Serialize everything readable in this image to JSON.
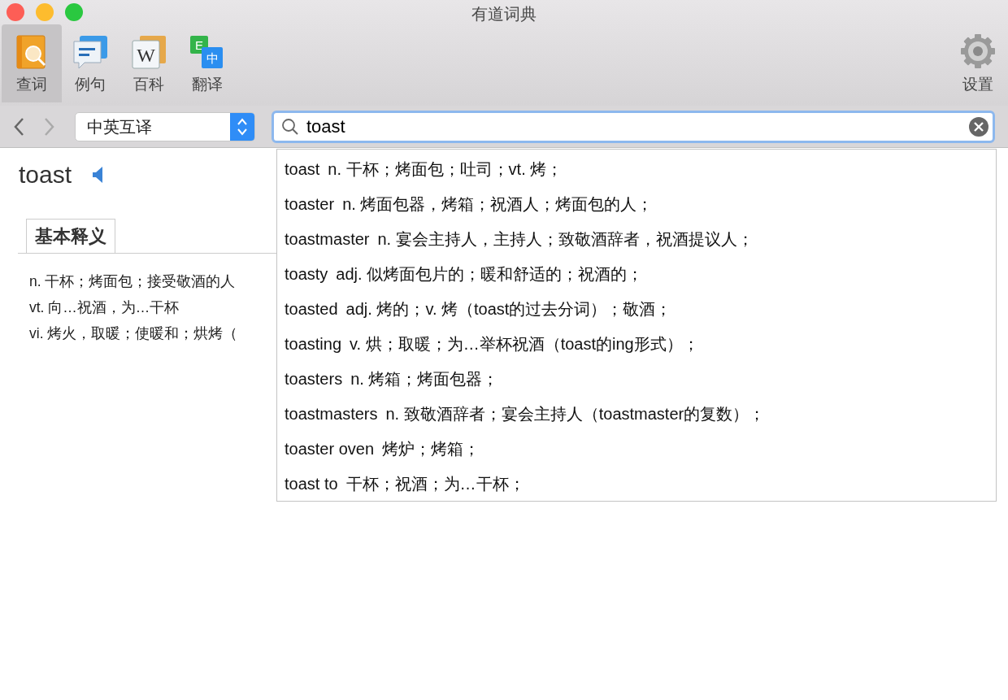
{
  "window": {
    "title": "有道词典"
  },
  "toolbar": {
    "items": [
      {
        "label": "查词",
        "kind": "lookup",
        "selected": true
      },
      {
        "label": "例句",
        "kind": "examples",
        "selected": false
      },
      {
        "label": "百科",
        "kind": "wiki",
        "icon_text": [
          "W"
        ],
        "selected": false
      },
      {
        "label": "翻译",
        "kind": "translate",
        "icon_text": [
          "E",
          "中"
        ],
        "selected": false
      }
    ],
    "settings": {
      "label": "设置"
    }
  },
  "nav": {
    "mode_select": {
      "value": "中英互译"
    },
    "search": {
      "value": "toast"
    }
  },
  "entry": {
    "word": "toast",
    "tabs": [
      {
        "label": "基本释义",
        "selected": true
      }
    ],
    "definitions": [
      "n. 干杯；烤面包；接受敬酒的人",
      "vt. 向…祝酒，为…干杯",
      "vi. 烤火，取暖；使暖和；烘烤（"
    ]
  },
  "suggestions": [
    {
      "word": "toast",
      "meaning": "n. 干杯；烤面包；吐司；vt. 烤；"
    },
    {
      "word": "toaster",
      "meaning": "n. 烤面包器，烤箱；祝酒人；烤面包的人；"
    },
    {
      "word": "toastmaster",
      "meaning": "n. 宴会主持人，主持人；致敬酒辞者，祝酒提议人；"
    },
    {
      "word": "toasty",
      "meaning": "adj. 似烤面包片的；暖和舒适的；祝酒的；"
    },
    {
      "word": "toasted",
      "meaning": "adj. 烤的；v. 烤（toast的过去分词）；敬酒；"
    },
    {
      "word": "toasting",
      "meaning": "v. 烘；取暖；为…举杯祝酒（toast的ing形式）；"
    },
    {
      "word": "toasters",
      "meaning": "n. 烤箱；烤面包器；"
    },
    {
      "word": "toastmasters",
      "meaning": "n. 致敬酒辞者；宴会主持人（toastmaster的复数）；"
    },
    {
      "word": "toaster oven",
      "meaning": "烤炉；烤箱；"
    },
    {
      "word": "toast to",
      "meaning": "干杯；祝酒；为…干杯；"
    }
  ]
}
